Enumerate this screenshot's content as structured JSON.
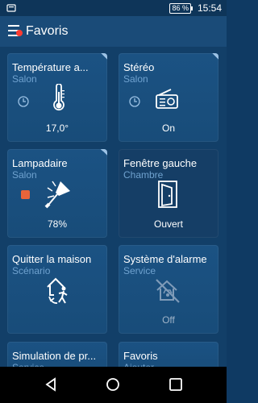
{
  "status": {
    "battery": "86 %",
    "time": "15:54"
  },
  "appbar": {
    "title": "Favoris"
  },
  "tiles": [
    {
      "name": "Température a...",
      "sub": "Salon",
      "value": "17,0°",
      "icon": "thermometer-icon"
    },
    {
      "name": "Stéréo",
      "sub": "Salon",
      "value": "On",
      "icon": "radio-icon"
    },
    {
      "name": "Lampadaire",
      "sub": "Salon",
      "value": "78%",
      "icon": "lamp-icon",
      "swatch": "#e8643a"
    },
    {
      "name": "Fenêtre gauche",
      "sub": "Chambre",
      "value": "Ouvert",
      "icon": "window-open-icon"
    },
    {
      "name": "Quitter la maison",
      "sub": "Scénario",
      "value": "",
      "icon": "leave-home-icon"
    },
    {
      "name": "Système d'alarme",
      "sub": "Service",
      "value": "Off",
      "icon": "alarm-off-icon"
    },
    {
      "name": "Simulation de pr...",
      "sub": "Service",
      "value": "",
      "icon": ""
    },
    {
      "name": "Favoris",
      "sub": "Ajouter",
      "value": "",
      "icon": ""
    }
  ]
}
